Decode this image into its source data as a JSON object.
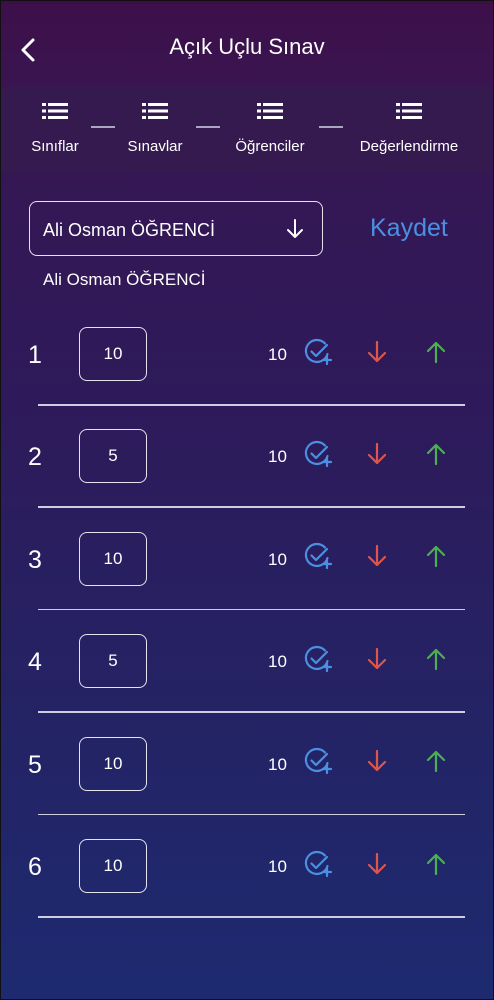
{
  "header": {
    "title": "Açık Uçlu Sınav"
  },
  "steps": [
    {
      "label": "Sınıflar"
    },
    {
      "label": "Sınavlar"
    },
    {
      "label": "Öğrenciler"
    },
    {
      "label": "Değerlendirme"
    }
  ],
  "student_select": {
    "value": "Ali Osman ÖĞRENCİ"
  },
  "save_label": "Kaydet",
  "student_name": "Ali Osman ÖĞRENCİ",
  "questions": [
    {
      "number": "1",
      "score": "10",
      "max": "10"
    },
    {
      "number": "2",
      "score": "5",
      "max": "10"
    },
    {
      "number": "3",
      "score": "10",
      "max": "10"
    },
    {
      "number": "4",
      "score": "5",
      "max": "10"
    },
    {
      "number": "5",
      "score": "10",
      "max": "10"
    },
    {
      "number": "6",
      "score": "10",
      "max": "10"
    }
  ],
  "colors": {
    "accent_blue": "#4a90e2",
    "down_red": "#e0554a",
    "up_green": "#4caf50"
  },
  "icons": {
    "back": "chevron-left-icon",
    "step": "list-icon",
    "dropdown": "arrow-down-icon",
    "full_score": "check-circle-plus-icon",
    "decrease": "arrow-down-icon",
    "increase": "arrow-up-icon"
  }
}
